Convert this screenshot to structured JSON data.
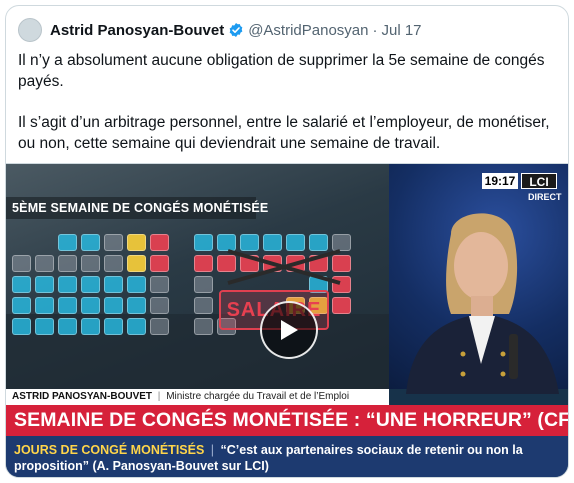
{
  "tweet": {
    "author_name": "Astrid Panosyan-Bouvet",
    "handle": "@AstridPanosyan",
    "separator": "·",
    "date": "Jul 17",
    "paragraphs": [
      "Il n’y a absolument aucune obligation de supprimer la 5e semaine de congés payés.",
      "Il s’agit d’un arbitrage personnel, entre le salarié et l’employeur, de monétiser, ou non, cette semaine qui deviendrait une semaine de travail."
    ]
  },
  "video": {
    "panel_title": "5ÈME SEMAINE DE CONGÉS MONÉTISÉE",
    "salaire_label": "SALAIRE",
    "clock": "19:17",
    "channel": "LCI",
    "live_label": "DIRECT",
    "guest_name": "ASTRID PANOSYAN-BOUVET",
    "guest_role": "Ministre chargée du Travail et de l’Emploi",
    "headline": "SEMAINE DE CONGÉS MONÉTISÉE : “UNE HORREUR” (CFDT)",
    "sub_kicker": "JOURS DE CONGÉ MONÉTISÉS",
    "sub_separator": "|",
    "sub_quote": "“C’est aux partenaires sociaux de retenir ou non la proposition” (A. Panosyan-Bouvet sur LCI)"
  },
  "colors": {
    "headline_red": "#d6213a",
    "sub_navy": "#1d3a70",
    "verified_blue": "#1d9bf0"
  },
  "icons": [
    "verified-badge-icon",
    "play-icon"
  ]
}
